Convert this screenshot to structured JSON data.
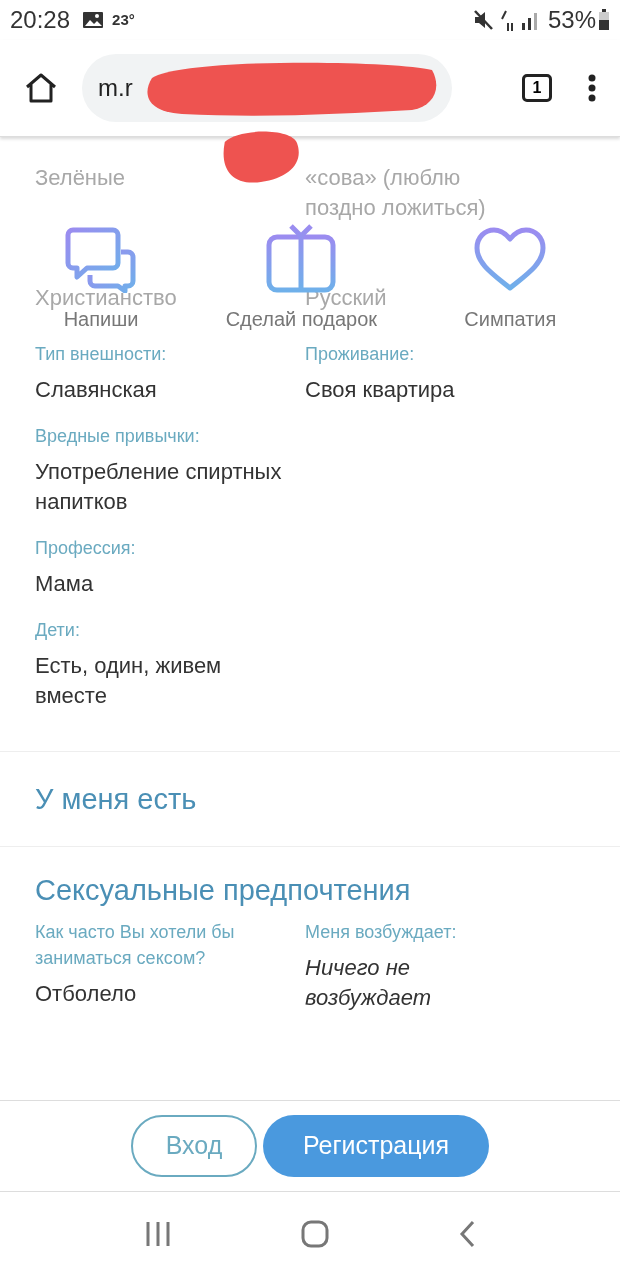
{
  "status_bar": {
    "time": "20:28",
    "temperature": "23°",
    "battery": "53%"
  },
  "browser": {
    "url": "m.r",
    "tab_count": "1"
  },
  "faded_rows": [
    [
      "Зелёные",
      "«сова» (люблю поздно ложиться)"
    ],
    [
      "Христианство",
      "Русский"
    ]
  ],
  "actions": [
    {
      "kind": "chat",
      "label": "Напиши"
    },
    {
      "kind": "gift",
      "label": "Сделай подарок"
    },
    {
      "kind": "heart",
      "label": "Симпатия"
    }
  ],
  "fields": [
    {
      "label": "Тип внешности:",
      "value": "Славянская",
      "label_2": "Проживание:",
      "value_2": "Своя квартира"
    },
    {
      "label": "Вредные привычки:",
      "value": "Употребление спиртных напитков"
    },
    {
      "label": "Профессия:",
      "value": "Мама"
    },
    {
      "label": "Дети:",
      "value": "Есть, один, живем вместе"
    }
  ],
  "sections": [
    {
      "title": "У меня есть"
    },
    {
      "title": "Сексуальные предпочтения",
      "fields": [
        {
          "label": "Как часто Вы хотели бы заниматься сексом?",
          "value": "Отболело",
          "italic": false
        },
        {
          "label": "Меня возбуждает:",
          "value": "Ничего не возбуждает",
          "italic": true
        }
      ]
    }
  ],
  "buttons": [
    {
      "label": "Вход",
      "kind": "outline"
    },
    {
      "label": "Регистрация",
      "kind": "filled"
    }
  ]
}
